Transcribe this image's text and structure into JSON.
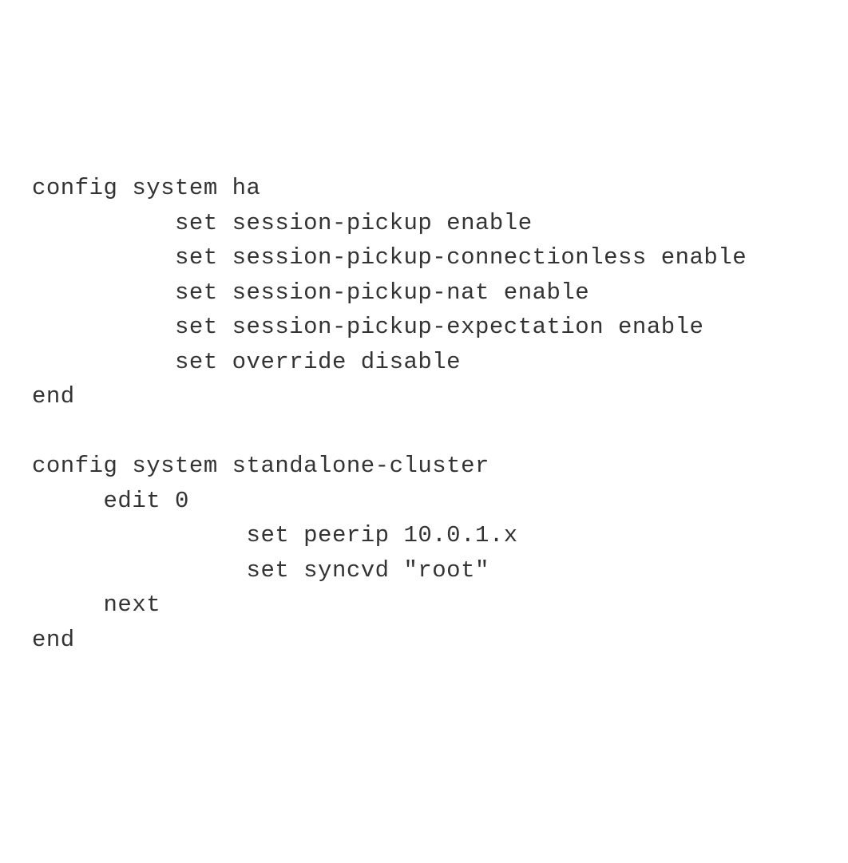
{
  "code": {
    "lines": [
      {
        "indent": 0,
        "text": "config system ha"
      },
      {
        "indent": 2,
        "text": "set session-pickup enable"
      },
      {
        "indent": 2,
        "text": "set session-pickup-connectionless enable"
      },
      {
        "indent": 2,
        "text": "set session-pickup-nat enable"
      },
      {
        "indent": 2,
        "text": "set session-pickup-expectation enable"
      },
      {
        "indent": 2,
        "text": "set override disable"
      },
      {
        "indent": 0,
        "text": "end"
      },
      {
        "indent": 0,
        "text": ""
      },
      {
        "indent": 0,
        "text": "config system standalone-cluster"
      },
      {
        "indent": 1,
        "text": "edit 0"
      },
      {
        "indent": 3,
        "text": "set peerip 10.0.1.x"
      },
      {
        "indent": 3,
        "text": "set syncvd \"root\""
      },
      {
        "indent": 1,
        "text": "next"
      },
      {
        "indent": 0,
        "text": "end"
      }
    ]
  },
  "indent_unit": "     "
}
